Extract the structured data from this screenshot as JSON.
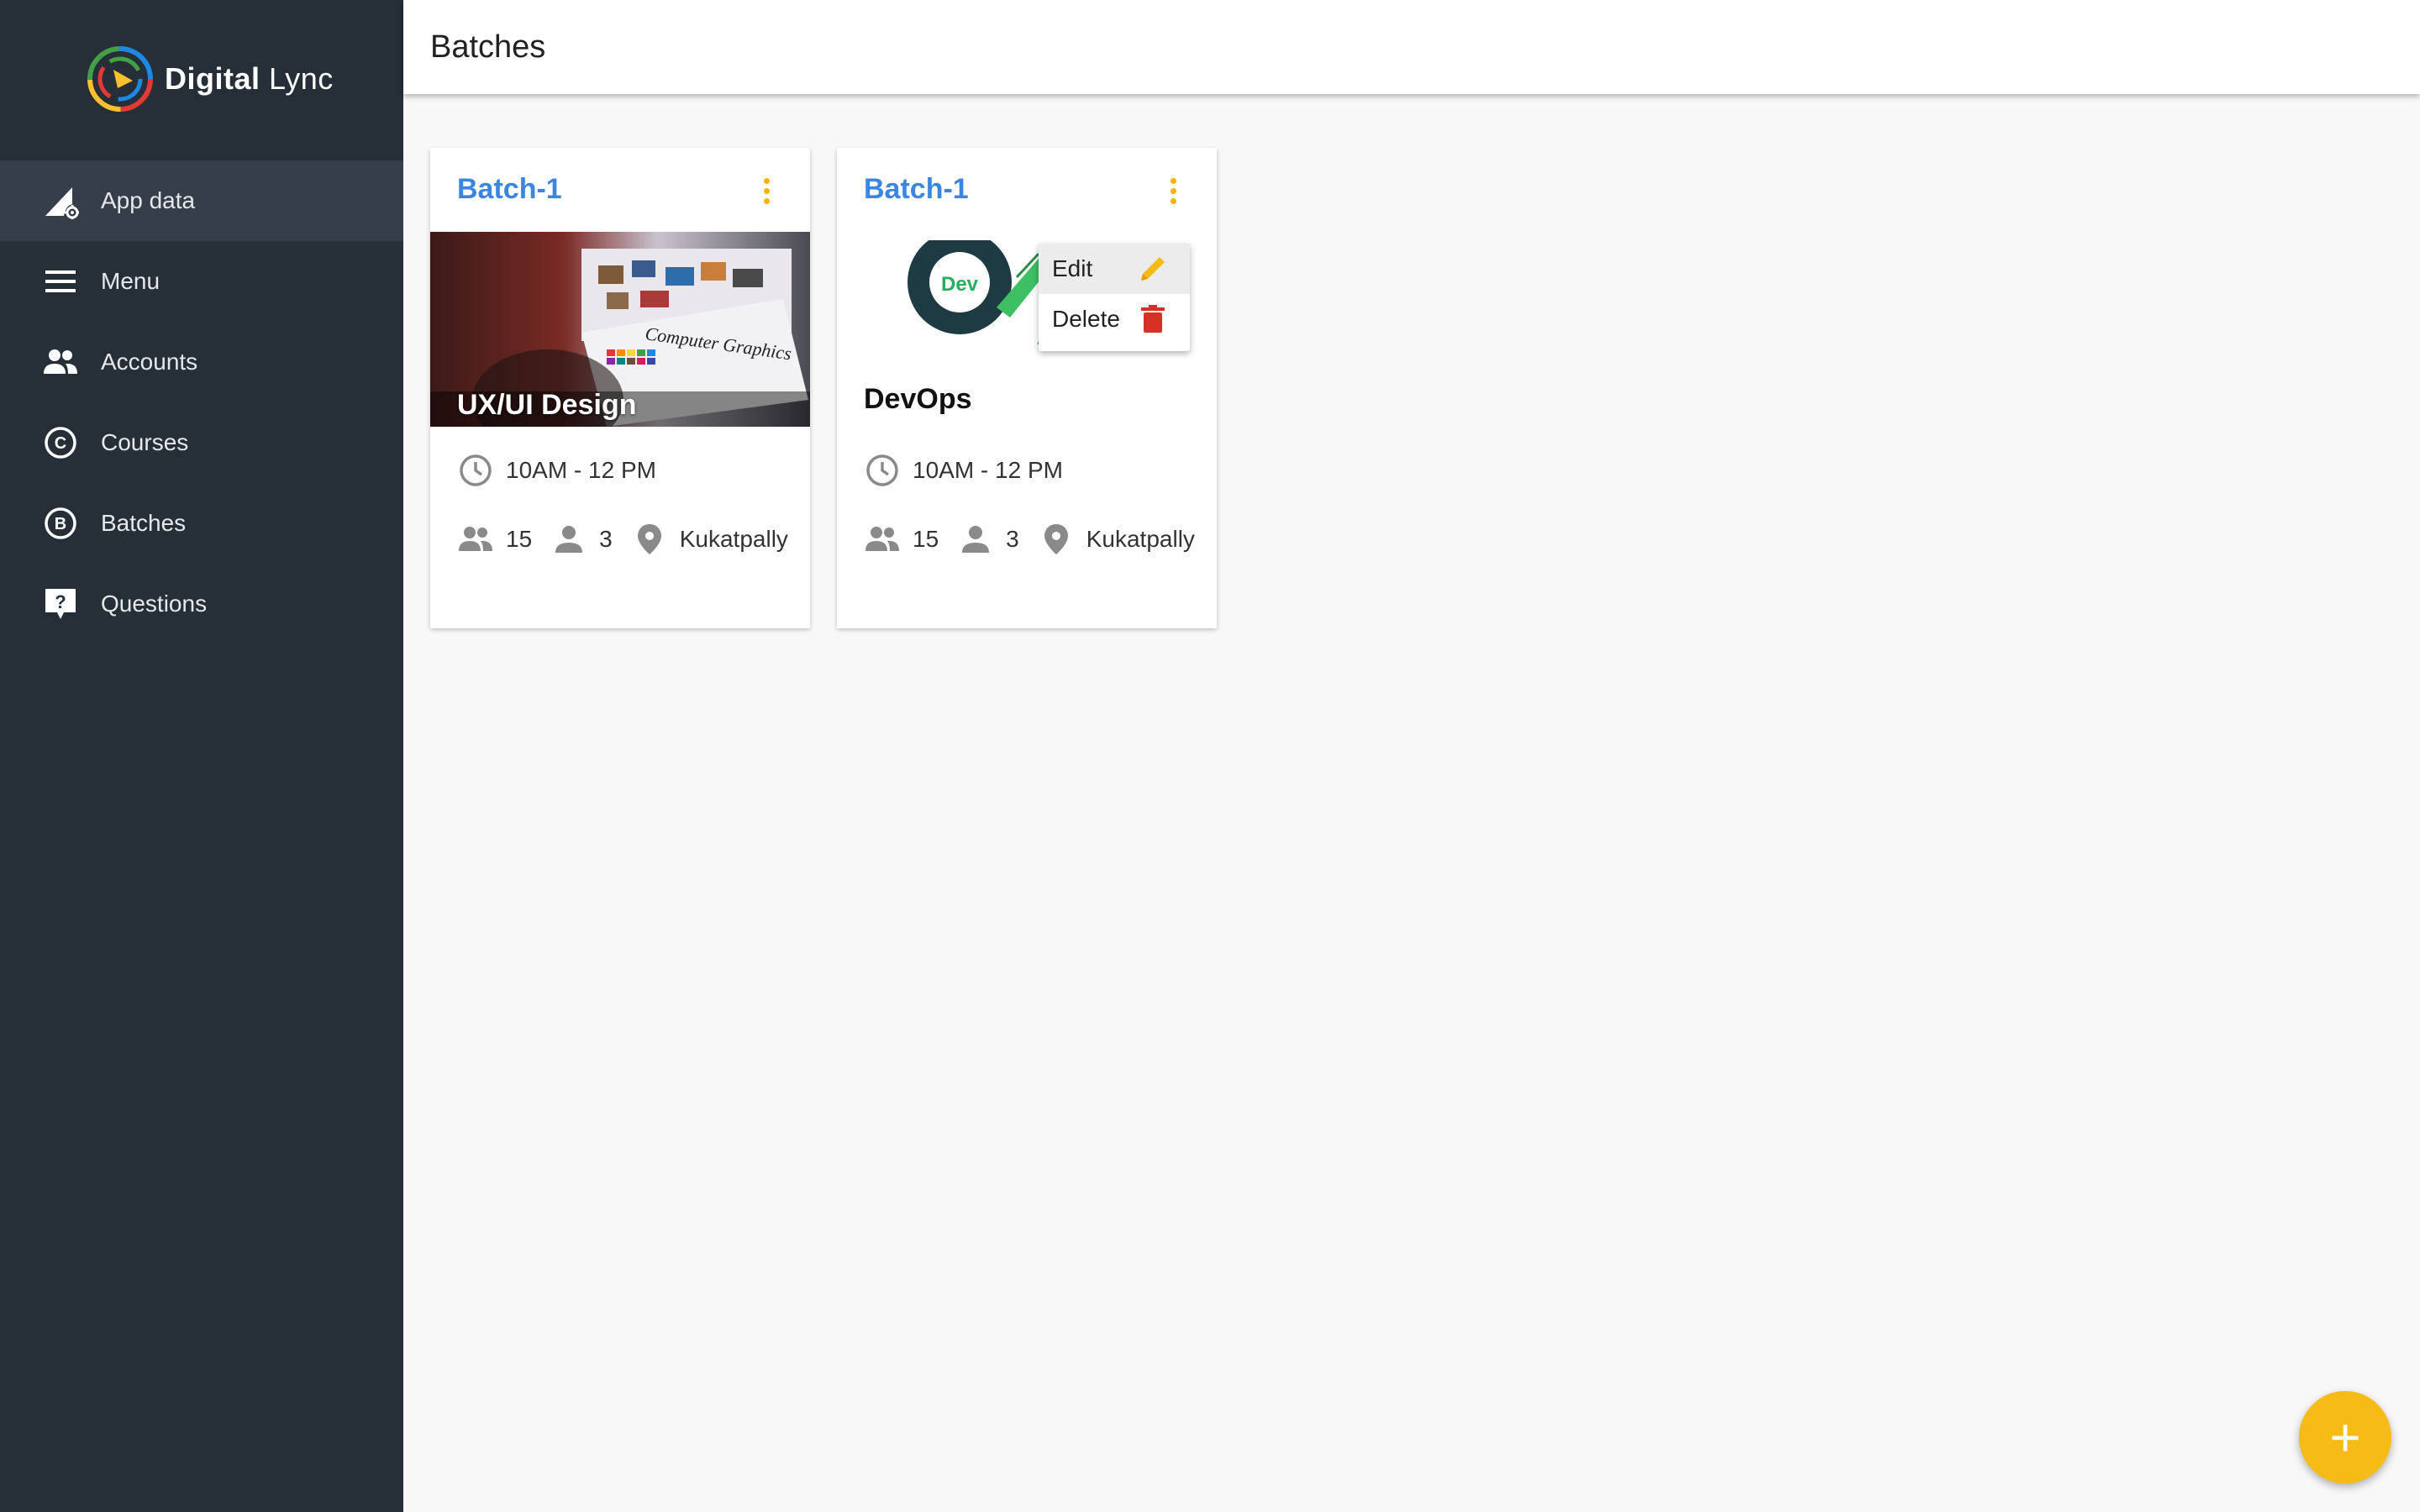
{
  "brand": {
    "name_bold": "Digital",
    "name_light": " Lync"
  },
  "header": {
    "title": "Batches"
  },
  "sidebar": {
    "items": [
      {
        "label": "App data",
        "icon": "app-data-icon",
        "active": true
      },
      {
        "label": "Menu",
        "icon": "menu-icon"
      },
      {
        "label": "Accounts",
        "icon": "accounts-icon"
      },
      {
        "label": "Courses",
        "icon": "courses-icon"
      },
      {
        "label": "Batches",
        "icon": "batches-icon"
      },
      {
        "label": "Questions",
        "icon": "questions-icon"
      }
    ]
  },
  "cards": [
    {
      "title": "Batch-1",
      "media_label": "UX/UI Design",
      "media_text": "Computer Graphics",
      "time": "10AM - 12 PM",
      "students": "15",
      "trainers": "3",
      "location": "Kukatpally"
    },
    {
      "title": "Batch-1",
      "course": "DevOps",
      "media_text": "Dev",
      "time": "10AM - 12 PM",
      "students": "15",
      "trainers": "3",
      "location": "Kukatpally"
    }
  ],
  "context_menu": {
    "edit": "Edit",
    "delete": "Delete"
  },
  "fab": {
    "label": "+"
  },
  "colors": {
    "sidebar": "#262e38",
    "accent": "#f7bb16",
    "link": "#3a86e0",
    "danger": "#d93025"
  }
}
